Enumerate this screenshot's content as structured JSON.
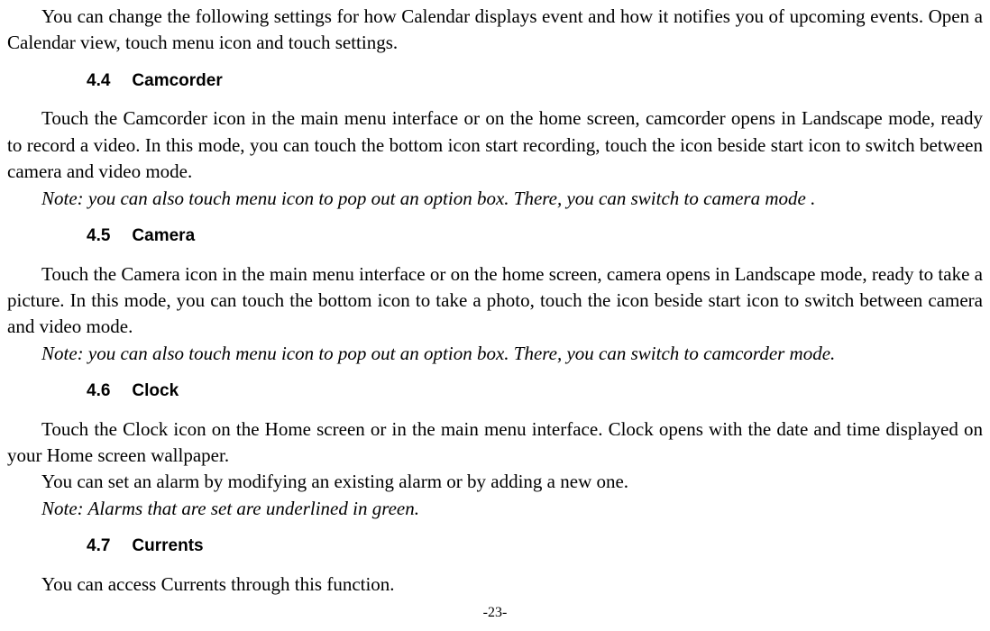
{
  "intro": "You can change the following settings for how Calendar displays event and how it notifies you of upcoming events. Open a Calendar view, touch menu icon and touch settings.",
  "sections": [
    {
      "num": "4.4",
      "title": "Camcorder",
      "body": "Touch the Camcorder icon in the main menu interface or on the home screen, camcorder opens in Landscape mode, ready to record a video. In this mode, you can touch the bottom icon start recording, touch the icon beside start icon to switch between camera and video mode.",
      "note": "Note: you can also touch menu icon to pop out an option box. There, you can switch to camera mode ."
    },
    {
      "num": "4.5",
      "title": "Camera",
      "body": "Touch the Camera icon in the main menu interface or on the home screen, camera opens in Landscape mode, ready to take a picture. In this mode, you can touch the bottom icon to take a photo, touch the icon beside start icon to switch between camera and video mode.",
      "note": "Note: you can also touch menu icon to pop out an option box. There, you can switch to camcorder mode."
    },
    {
      "num": "4.6",
      "title": "Clock",
      "body": "Touch the Clock icon on the Home screen or in the main menu interface. Clock opens with the date and time displayed on your Home screen wallpaper.",
      "body2": "You can set an alarm by modifying an existing alarm or by adding a new one.",
      "note": "Note: Alarms that are set are underlined in green."
    },
    {
      "num": "4.7",
      "title": "Currents",
      "body": "You can access Currents through this function."
    }
  ],
  "page_number": "-23-"
}
